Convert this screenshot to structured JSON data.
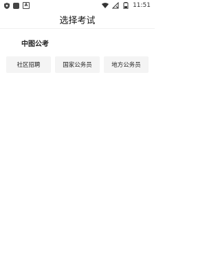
{
  "status_bar": {
    "time": "11:51",
    "icons": [
      "shield-icon",
      "app-square-icon",
      "a-badge-icon",
      "wifi-icon",
      "no-signal-icon",
      "battery-icon"
    ]
  },
  "header": {
    "title": "选择考试"
  },
  "exam_section": {
    "title": "中图公考",
    "options": [
      {
        "label": "社区招聘"
      },
      {
        "label": "国家公务员"
      },
      {
        "label": "地方公务员"
      }
    ]
  }
}
